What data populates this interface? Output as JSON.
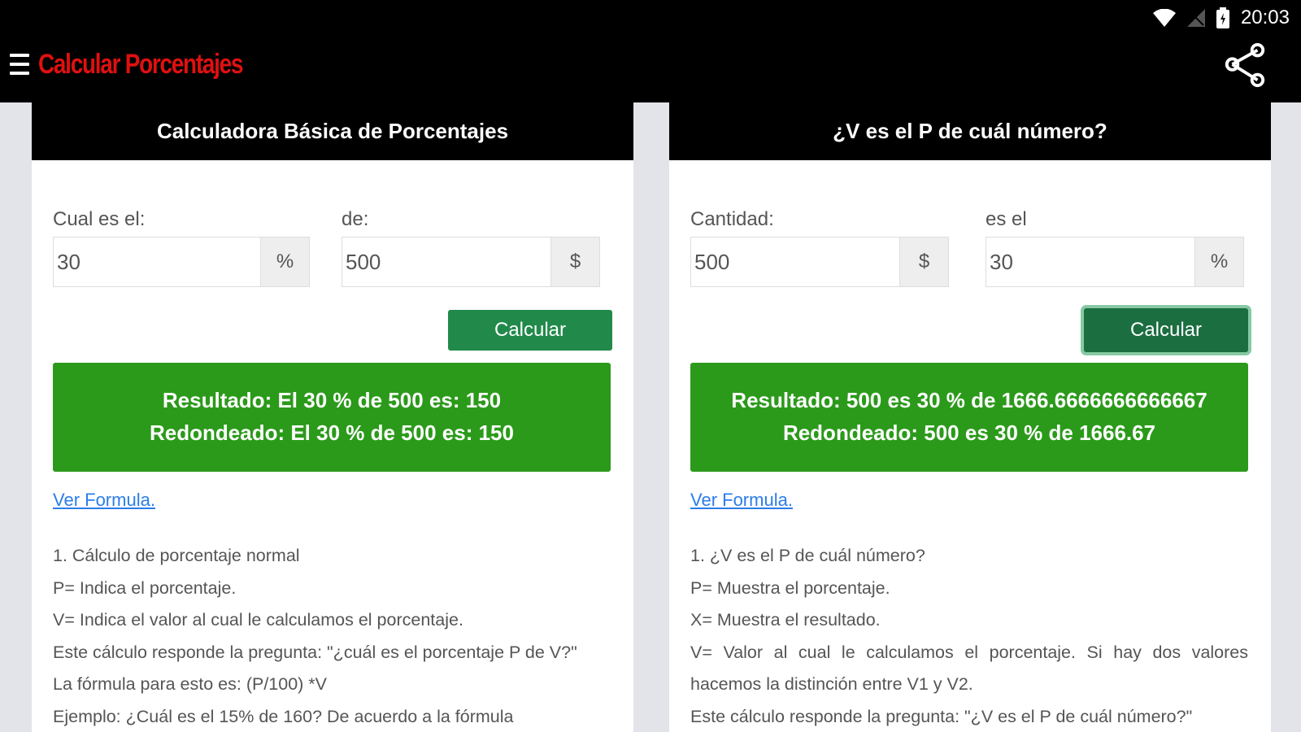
{
  "status_bar": {
    "time": "20:03",
    "icons": [
      "wifi-icon",
      "no-signal-icon",
      "battery-icon"
    ]
  },
  "app_bar": {
    "title": "Calcular Porcentajes",
    "title_color": "#e01010",
    "icons": [
      "hamburger-menu-icon",
      "share-icon"
    ]
  },
  "calculators": [
    {
      "header": "Calculadora Básica de Porcentajes",
      "field1": {
        "label": "Cual es el:",
        "value": "30",
        "addon": "%"
      },
      "field2": {
        "label": "de:",
        "value": "500",
        "addon": "$"
      },
      "button": "Calcular",
      "result_line1": "Resultado: El 30 % de 500 es: 150",
      "result_line2": "Redondeado: El 30 % de 500 es: 150",
      "formula_link": "Ver Formula.",
      "description": [
        "1. Cálculo de porcentaje normal",
        "P= Indica el porcentaje.",
        "V= Indica el valor al cual le calculamos el porcentaje.",
        "Este cálculo responde la pregunta: \"¿cuál es el porcentaje P de V?\"",
        "La fórmula para esto es: (P/100) *V",
        "Ejemplo: ¿Cuál es el 15% de 160? De acuerdo a la fórmula"
      ]
    },
    {
      "header": "¿V es el P de cuál número?",
      "field1": {
        "label": "Cantidad:",
        "value": "500",
        "addon": "$"
      },
      "field2": {
        "label": "es el",
        "value": "30",
        "addon": "%"
      },
      "button": "Calcular",
      "result_line1": "Resultado: 500 es 30 % de 1666.6666666666667",
      "result_line2": "Redondeado: 500 es 30 % de 1666.67",
      "formula_link": "Ver Formula.",
      "description": [
        "1. ¿V es el P de cuál número?",
        "P= Muestra el porcentaje.",
        "X= Muestra el resultado.",
        "V= Valor al cual le calculamos el porcentaje. Si hay dos valores hacemos la distinción entre V1 y V2.",
        "Este cálculo responde la pregunta: \"¿V es el P de cuál número?\""
      ]
    }
  ],
  "colors": {
    "button": "#218a4b",
    "result_bg": "#2b9a1a",
    "link": "#2b7de9",
    "background": "#e3e3ea"
  }
}
